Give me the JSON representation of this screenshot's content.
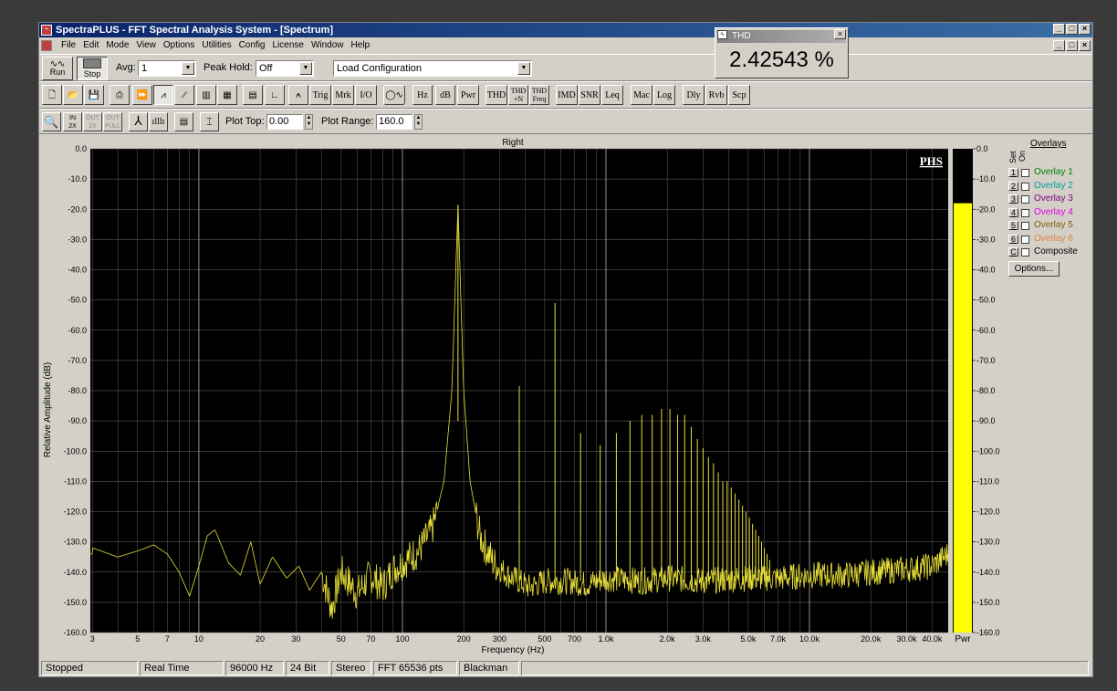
{
  "window": {
    "title": "SpectraPLUS - FFT Spectral Analysis System - [Spectrum]"
  },
  "menu": [
    "File",
    "Edit",
    "Mode",
    "View",
    "Options",
    "Utilities",
    "Config",
    "License",
    "Window",
    "Help"
  ],
  "toolbar1": {
    "run_label": "Run",
    "stop_label": "Stop",
    "avg_label": "Avg:",
    "avg_value": "1",
    "peakhold_label": "Peak Hold:",
    "peakhold_value": "Off",
    "config_value": "Load Configuration"
  },
  "toolbar2": {
    "trig": "Trig",
    "mrk": "Mrk",
    "io": "I/O",
    "hz": "Hz",
    "db": "dB",
    "pwr": "Pwr",
    "thd": "THD",
    "thdn_top": "THD",
    "thdn_bot": "+N",
    "thdf_top": "THD",
    "thdf_bot": "Freq",
    "imd": "IMD",
    "snr": "SNR",
    "leq": "Leq",
    "mac": "Mac",
    "log": "Log",
    "dly": "Dly",
    "rvb": "Rvb",
    "scp": "Scp"
  },
  "toolbar3": {
    "zin": "IN",
    "zin2": "2X",
    "zout": "OUT",
    "zout2": "2X",
    "zout3": "OUT",
    "zout4": "FULL",
    "plot_top_label": "Plot Top:",
    "plot_top_value": "0.00",
    "plot_range_label": "Plot Range:",
    "plot_range_value": "160.0"
  },
  "thd_meter": {
    "title": "THD",
    "value": "2.42543 %"
  },
  "chart_data": {
    "type": "line",
    "title": "Right",
    "xlabel": "Frequency (Hz)",
    "ylabel": "Relative Amplitude (dB)",
    "xscale": "log",
    "xlim": [
      2.93,
      48000
    ],
    "ylim": [
      -160,
      0
    ],
    "grid": true,
    "watermark": "PHS",
    "xticks": [
      {
        "v": 3,
        "t": "3"
      },
      {
        "v": 5,
        "t": "5"
      },
      {
        "v": 7,
        "t": "7"
      },
      {
        "v": 10,
        "t": "10"
      },
      {
        "v": 20,
        "t": "20"
      },
      {
        "v": 30,
        "t": "30"
      },
      {
        "v": 50,
        "t": "50"
      },
      {
        "v": 70,
        "t": "70"
      },
      {
        "v": 100,
        "t": "100"
      },
      {
        "v": 200,
        "t": "200"
      },
      {
        "v": 300,
        "t": "300"
      },
      {
        "v": 500,
        "t": "500"
      },
      {
        "v": 700,
        "t": "700"
      },
      {
        "v": 1000,
        "t": "1.0k"
      },
      {
        "v": 2000,
        "t": "2.0k"
      },
      {
        "v": 3000,
        "t": "3.0k"
      },
      {
        "v": 5000,
        "t": "5.0k"
      },
      {
        "v": 7000,
        "t": "7.0k"
      },
      {
        "v": 10000,
        "t": "10.0k"
      },
      {
        "v": 20000,
        "t": "20.0k"
      },
      {
        "v": 30000,
        "t": "30.0k"
      },
      {
        "v": 40000,
        "t": "40.0k"
      }
    ],
    "yticks": [
      "0.0",
      "-10.0",
      "-20.0",
      "-30.0",
      "-40.0",
      "-50.0",
      "-60.0",
      "-70.0",
      "-80.0",
      "-90.0",
      "-100.0",
      "-110.0",
      "-120.0",
      "-130.0",
      "-140.0",
      "-150.0",
      "-160.0"
    ],
    "fundamental": {
      "freq": 187.5,
      "level": -18.5
    },
    "harmonics": [
      {
        "freq": 375,
        "level": -78.5
      },
      {
        "freq": 562,
        "level": -51
      },
      {
        "freq": 750,
        "level": -94
      },
      {
        "freq": 937,
        "level": -98
      },
      {
        "freq": 1125,
        "level": -94
      },
      {
        "freq": 1312,
        "level": -90
      },
      {
        "freq": 1500,
        "level": -88
      },
      {
        "freq": 1687,
        "level": -88
      },
      {
        "freq": 1875,
        "level": -86
      },
      {
        "freq": 2062,
        "level": -86
      },
      {
        "freq": 2250,
        "level": -88
      },
      {
        "freq": 2437,
        "level": -88
      },
      {
        "freq": 2625,
        "level": -92
      },
      {
        "freq": 2812,
        "level": -96
      },
      {
        "freq": 3000,
        "level": -99
      },
      {
        "freq": 3187,
        "level": -102
      },
      {
        "freq": 3375,
        "level": -104
      },
      {
        "freq": 3562,
        "level": -107
      },
      {
        "freq": 3750,
        "level": -110
      },
      {
        "freq": 3937,
        "level": -110
      },
      {
        "freq": 4125,
        "level": -112
      },
      {
        "freq": 4312,
        "level": -114
      },
      {
        "freq": 4500,
        "level": -116
      },
      {
        "freq": 4687,
        "level": -118
      },
      {
        "freq": 4875,
        "level": -120
      },
      {
        "freq": 5062,
        "level": -122
      },
      {
        "freq": 5250,
        "level": -124
      },
      {
        "freq": 5437,
        "level": -126
      },
      {
        "freq": 5625,
        "level": -128
      },
      {
        "freq": 5812,
        "level": -130
      },
      {
        "freq": 6000,
        "level": -132
      },
      {
        "freq": 6187,
        "level": -134
      },
      {
        "freq": 6375,
        "level": -136
      }
    ],
    "noise_floor": [
      {
        "f": 3,
        "v": -132
      },
      {
        "f": 4,
        "v": -135
      },
      {
        "f": 5,
        "v": -133
      },
      {
        "f": 6,
        "v": -131
      },
      {
        "f": 7,
        "v": -134
      },
      {
        "f": 8,
        "v": -140
      },
      {
        "f": 9,
        "v": -148
      },
      {
        "f": 10,
        "v": -138
      },
      {
        "f": 11,
        "v": -128
      },
      {
        "f": 12,
        "v": -126
      },
      {
        "f": 14,
        "v": -137
      },
      {
        "f": 16,
        "v": -141
      },
      {
        "f": 18,
        "v": -130
      },
      {
        "f": 20,
        "v": -144
      },
      {
        "f": 23,
        "v": -135
      },
      {
        "f": 27,
        "v": -142
      },
      {
        "f": 31,
        "v": -138
      },
      {
        "f": 35,
        "v": -146
      },
      {
        "f": 40,
        "v": -140
      },
      {
        "f": 45,
        "v": -152
      },
      {
        "f": 50,
        "v": -140
      },
      {
        "f": 60,
        "v": -147
      },
      {
        "f": 70,
        "v": -141
      },
      {
        "f": 80,
        "v": -145
      },
      {
        "f": 90,
        "v": -139
      },
      {
        "f": 100,
        "v": -137
      },
      {
        "f": 120,
        "v": -133
      },
      {
        "f": 140,
        "v": -126
      },
      {
        "f": 160,
        "v": -110
      },
      {
        "f": 175,
        "v": -80
      },
      {
        "f": 187.5,
        "v": -18.5
      },
      {
        "f": 200,
        "v": -80
      },
      {
        "f": 215,
        "v": -110
      },
      {
        "f": 240,
        "v": -128
      },
      {
        "f": 280,
        "v": -137
      },
      {
        "f": 330,
        "v": -141
      },
      {
        "f": 420,
        "v": -145
      },
      {
        "f": 500,
        "v": -143
      },
      {
        "f": 650,
        "v": -143
      },
      {
        "f": 800,
        "v": -144
      },
      {
        "f": 1000,
        "v": -142
      },
      {
        "f": 1500,
        "v": -143
      },
      {
        "f": 2000,
        "v": -142
      },
      {
        "f": 3000,
        "v": -143
      },
      {
        "f": 5000,
        "v": -142
      },
      {
        "f": 7000,
        "v": -142
      },
      {
        "f": 10000,
        "v": -141
      },
      {
        "f": 15000,
        "v": -141
      },
      {
        "f": 20000,
        "v": -140
      },
      {
        "f": 30000,
        "v": -139
      },
      {
        "f": 40000,
        "v": -138
      },
      {
        "f": 48000,
        "v": -134
      }
    ],
    "trace_color": "#e8e038"
  },
  "bargraph": {
    "level": -18,
    "label": "Pwr",
    "color": "#ffff00",
    "ticks": [
      "0.0",
      "-10.0",
      "-20.0",
      "-30.0",
      "-40.0",
      "-50.0",
      "-60.0",
      "-70.0",
      "-80.0",
      "-90.0",
      "-100.0",
      "-110.0",
      "-120.0",
      "-130.0",
      "-140.0",
      "-150.0",
      "-160.0"
    ]
  },
  "overlays": {
    "title": "Overlays",
    "set_label": "Set",
    "on_label": "On",
    "items": [
      {
        "num": "1",
        "label": "Overlay 1",
        "color": "#008000"
      },
      {
        "num": "2",
        "label": "Overlay 2",
        "color": "#00a0a0"
      },
      {
        "num": "3",
        "label": "Overlay 3",
        "color": "#800080"
      },
      {
        "num": "4",
        "label": "Overlay 4",
        "color": "#e000e0"
      },
      {
        "num": "5",
        "label": "Overlay 5",
        "color": "#806000"
      },
      {
        "num": "6",
        "label": "Overlay 6",
        "color": "#e08040"
      },
      {
        "num": "C",
        "label": "Composite",
        "color": "#000000"
      }
    ],
    "options_label": "Options..."
  },
  "status": [
    "Stopped",
    "Real Time",
    "96000 Hz",
    "24 Bit",
    "Stereo",
    "FFT 65536 pts",
    "Blackman"
  ]
}
